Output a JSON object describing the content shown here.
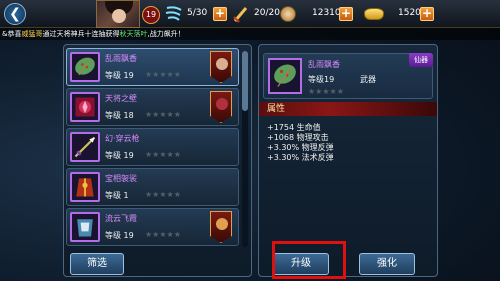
{
  "topbar": {
    "back_icon": "back-arrow-icon",
    "player_level": "19",
    "stamina": "5/30",
    "energy": "20/20",
    "silver": "12310",
    "gold": "1520",
    "plus_label": "+"
  },
  "broadcast": {
    "prefix": "&恭喜",
    "player": "威猛哥",
    "middle": "通过天将神兵十连抽获得",
    "item": "秋天落叶",
    "suffix": ",战力飙升！"
  },
  "equipment_list": {
    "items": [
      {
        "name": "乱雨飘香",
        "level_label": "等级 19",
        "stars": "★★★★★",
        "has_hero": true
      },
      {
        "name": "天将之壁",
        "level_label": "等级 18",
        "stars": "★★★★★",
        "has_hero": true
      },
      {
        "name": "幻·穿云枪",
        "level_label": "等级 19",
        "stars": "★★★★★",
        "has_hero": false
      },
      {
        "name": "宝相袈裟",
        "level_label": "等级 1",
        "stars": "★★★★★",
        "has_hero": false
      },
      {
        "name": "流云飞霞",
        "level_label": "等级 19",
        "stars": "★★★★★",
        "has_hero": true
      }
    ],
    "filter_label": "筛选"
  },
  "detail": {
    "name": "乱雨飘香",
    "level_label": "等级19",
    "type_label": "武器",
    "stars": "★★★★★",
    "rarity_tag": "仙器",
    "attr_header": "属性",
    "attrs": [
      "+1754 生命值",
      "+1068 物理攻击",
      "+3.30% 物理反弹",
      "+3.30% 法术反弹"
    ],
    "upgrade_label": "升级",
    "enhance_label": "强化"
  },
  "colors": {
    "accent_purple": "#d98cff",
    "highlight_red": "#e01010",
    "attr_bar": "#8a1616"
  }
}
